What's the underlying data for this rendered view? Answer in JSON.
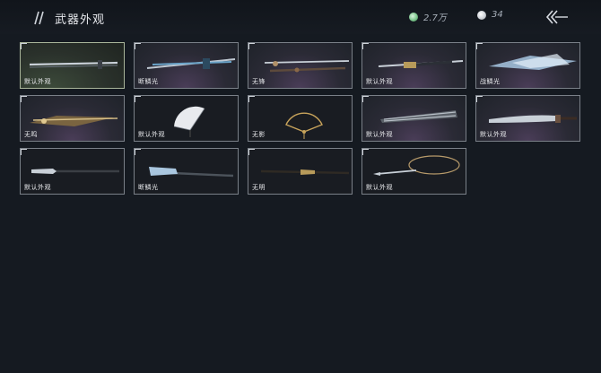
{
  "header": {
    "title": "武器外观",
    "jade_amount": "2.7万",
    "pearl_amount": "34"
  },
  "colors": {
    "background": "#151a21",
    "card_border": "#7a8088",
    "purple_glow": "#4a3d58"
  },
  "weapons": [
    {
      "label": "默认外观",
      "art": "long-sword",
      "tone": "green"
    },
    {
      "label": "断鳞光",
      "art": "blue-sword",
      "tone": "purple"
    },
    {
      "label": "无锋",
      "art": "ornate-sword",
      "tone": "purple"
    },
    {
      "label": "默认外观",
      "art": "gold-sword",
      "tone": "purple"
    },
    {
      "label": "战鳞光",
      "art": "ice-blade",
      "tone": "purple"
    },
    {
      "label": "无鸣",
      "art": "gold-blade",
      "tone": "purple"
    },
    {
      "label": "默认外观",
      "art": "white-fan",
      "tone": "dark"
    },
    {
      "label": "无影",
      "art": "black-fan",
      "tone": "dark"
    },
    {
      "label": "默认外观",
      "art": "folded-fan",
      "tone": "purple"
    },
    {
      "label": "默认外观",
      "art": "dao",
      "tone": "purple"
    },
    {
      "label": "默认外观",
      "art": "spear",
      "tone": "dark"
    },
    {
      "label": "断鳞光",
      "art": "ice-spear",
      "tone": "dark"
    },
    {
      "label": "无明",
      "art": "gold-spear",
      "tone": "dark"
    },
    {
      "label": "默认外观",
      "art": "rope-dart",
      "tone": "dark"
    }
  ]
}
